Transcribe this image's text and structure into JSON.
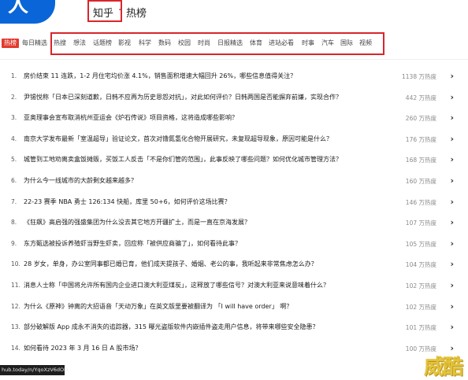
{
  "header": {
    "brand": "知乎",
    "separator": "·",
    "section": "热榜",
    "logo_glyph": "人"
  },
  "tabs": [
    {
      "label": "热榜",
      "active": true
    },
    {
      "label": "每日精选"
    },
    {
      "label": "热搜"
    },
    {
      "label": "想法"
    },
    {
      "label": "话题榜"
    },
    {
      "label": "影视"
    },
    {
      "label": "科学"
    },
    {
      "label": "数码"
    },
    {
      "label": "校园"
    },
    {
      "label": "时尚"
    },
    {
      "label": "日报精选"
    },
    {
      "label": "体育"
    },
    {
      "label": "进站必看"
    },
    {
      "label": "时事"
    },
    {
      "label": "汽车"
    },
    {
      "label": "国际"
    },
    {
      "label": "视频"
    }
  ],
  "items": [
    {
      "rank": "1.",
      "text": "房价结束 11 连跌，1-2 月住宅均价涨 4.1%，销售面积增速大幅回升 26%，哪些信息值得关注？",
      "heat": "1138 万热度"
    },
    {
      "rank": "2.",
      "text": "尹锡悦称「日本已深刻道歉，日韩不应再为历史恩怨对抗」，对此如何评价？日韩两国是否能摒弃前嫌，实现合作？",
      "heat": "442 万热度"
    },
    {
      "rank": "3.",
      "text": "亚奥理事会宣布取消杭州亚运会《炉石传说》项目资格，这将造成哪些影响？",
      "heat": "260 万热度"
    },
    {
      "rank": "4.",
      "text": "南京大学发布最新「室温超导」验证论文，首次对镥氮氢化合物开展研究，未复现超导现象，原因可能是什么？",
      "heat": "176 万热度"
    },
    {
      "rank": "5.",
      "text": "城管到工地劝离卖盒饭摊贩，买饭工人反击「不是你们管的范围」，此事反映了哪些问题？如何优化城市管理方法？",
      "heat": "168 万热度"
    },
    {
      "rank": "6.",
      "text": "为什么今一线城市的大龄剩女越来越多？",
      "heat": "160 万热度"
    },
    {
      "rank": "7.",
      "text": "22-23 赛季 NBA 勇士 126:134 快船，库里 50+6，如何评价这场比赛？",
      "heat": "146 万热度"
    },
    {
      "rank": "8.",
      "text": "《狂飙》高启强的强盛集团为什么没去其它地方开疆扩土，而是一直在京海发展？",
      "heat": "107 万热度"
    },
    {
      "rank": "9.",
      "text": "东方甄选被投诉养殖虾当野生虾卖，回应称「被供应商骗了」，如何看待此事？",
      "heat": "105 万热度"
    },
    {
      "rank": "10.",
      "text": "28 岁女，单身，办公室同事都已婚已育，他们成天提孩子、婚姻、老公的事，我听起来非常焦虑怎么办？",
      "heat": "104 万热度"
    },
    {
      "rank": "11.",
      "text": "消息人士称「中国将允许所有国内企业进口澳大利亚煤炭」，这释放了哪些信号？对澳大利亚来说意味着什么？",
      "heat": "102 万热度"
    },
    {
      "rank": "12.",
      "text": "为什么《原神》钟离的大招语音「天动万象」在英文版里要被翻译为 「I will have order」 啊？",
      "heat": "102 万热度"
    },
    {
      "rank": "13.",
      "text": "部分破解版 App 成永不消失的追踪器，315 曝光盗版软件内嵌插件盗走用户信息，将带来哪些安全隐患？",
      "heat": "101 万热度"
    },
    {
      "rank": "14.",
      "text": "如何看待 2023 年 3 月 16 日 A 股市场？",
      "heat": "100 万热度"
    }
  ],
  "status_url": "hub.today/n/YqoXzV6dOD",
  "watermark": "威酷",
  "colors": {
    "highlight_box": "#d9262b",
    "active_tab_bg": "#e23a2e",
    "logo_blue": "#0a66d8",
    "heat_text": "#8a8a8a",
    "watermark": "#e3c33a"
  },
  "icons": {
    "row_arrow": "chevron-right-icon"
  }
}
